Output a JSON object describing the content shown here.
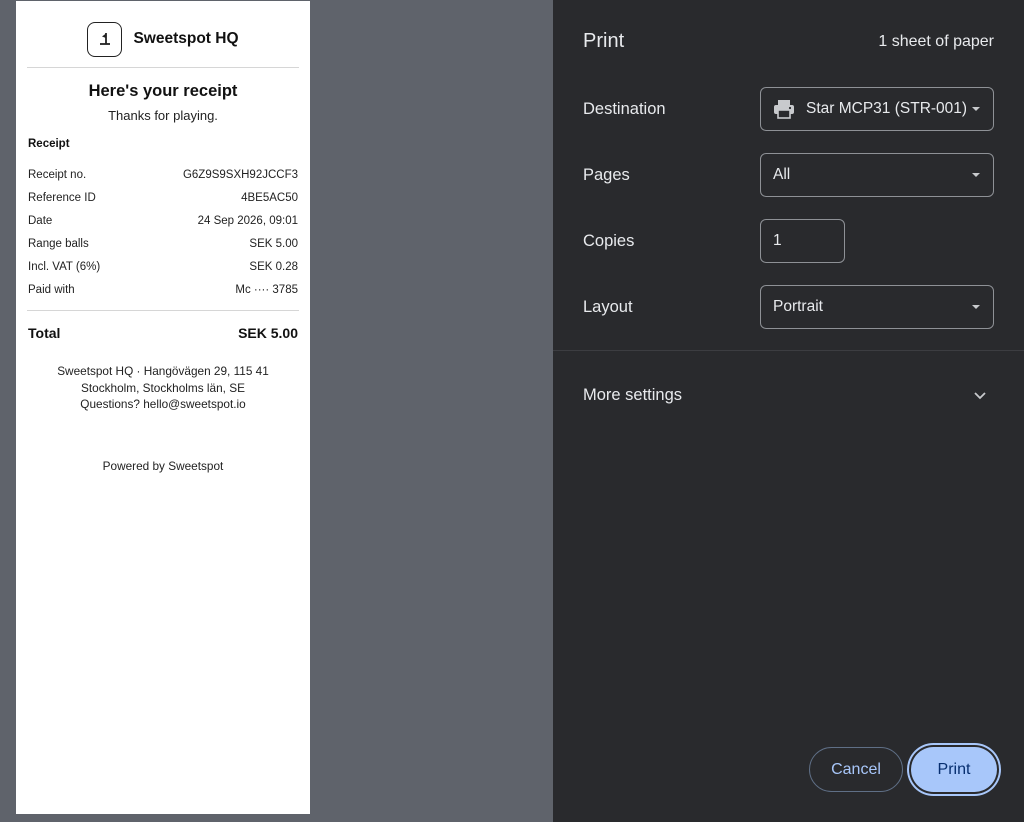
{
  "receipt": {
    "brand": "Sweetspot HQ",
    "title": "Here's your receipt",
    "subtitle": "Thanks for playing.",
    "section": "Receipt",
    "rows": [
      {
        "label": "Receipt no.",
        "value": "G6Z9S9SXH92JCCF3"
      },
      {
        "label": "Reference ID",
        "value": "4BE5AC50"
      },
      {
        "label": "Date",
        "value": "24 Sep 2026, 09:01"
      },
      {
        "label": "Range balls",
        "value": "SEK 5.00"
      },
      {
        "label": "Incl. VAT (6%)",
        "value": "SEK 0.28"
      },
      {
        "label": "Paid with",
        "value": "Mc ···· 3785"
      }
    ],
    "total_label": "Total",
    "total_value": "SEK 5.00",
    "address_line1": "Sweetspot HQ · Hangövägen 29, 115 41",
    "address_line2": "Stockholm, Stockholms län, SE",
    "address_line3": "Questions? hello@sweetspot.io",
    "powered_by": "Powered by Sweetspot"
  },
  "print": {
    "title": "Print",
    "sheets": "1 sheet of paper",
    "destination_label": "Destination",
    "destination_value": "Star MCP31 (STR-001)",
    "destination_icon": "printer-icon",
    "pages_label": "Pages",
    "pages_value": "All",
    "copies_label": "Copies",
    "copies_value": "1",
    "layout_label": "Layout",
    "layout_value": "Portrait",
    "more_settings_label": "More settings",
    "cancel_label": "Cancel",
    "print_label": "Print"
  },
  "colors": {
    "panel_bg": "#292a2d",
    "preview_bg": "#5f636b",
    "accent": "#a8c7fa"
  }
}
